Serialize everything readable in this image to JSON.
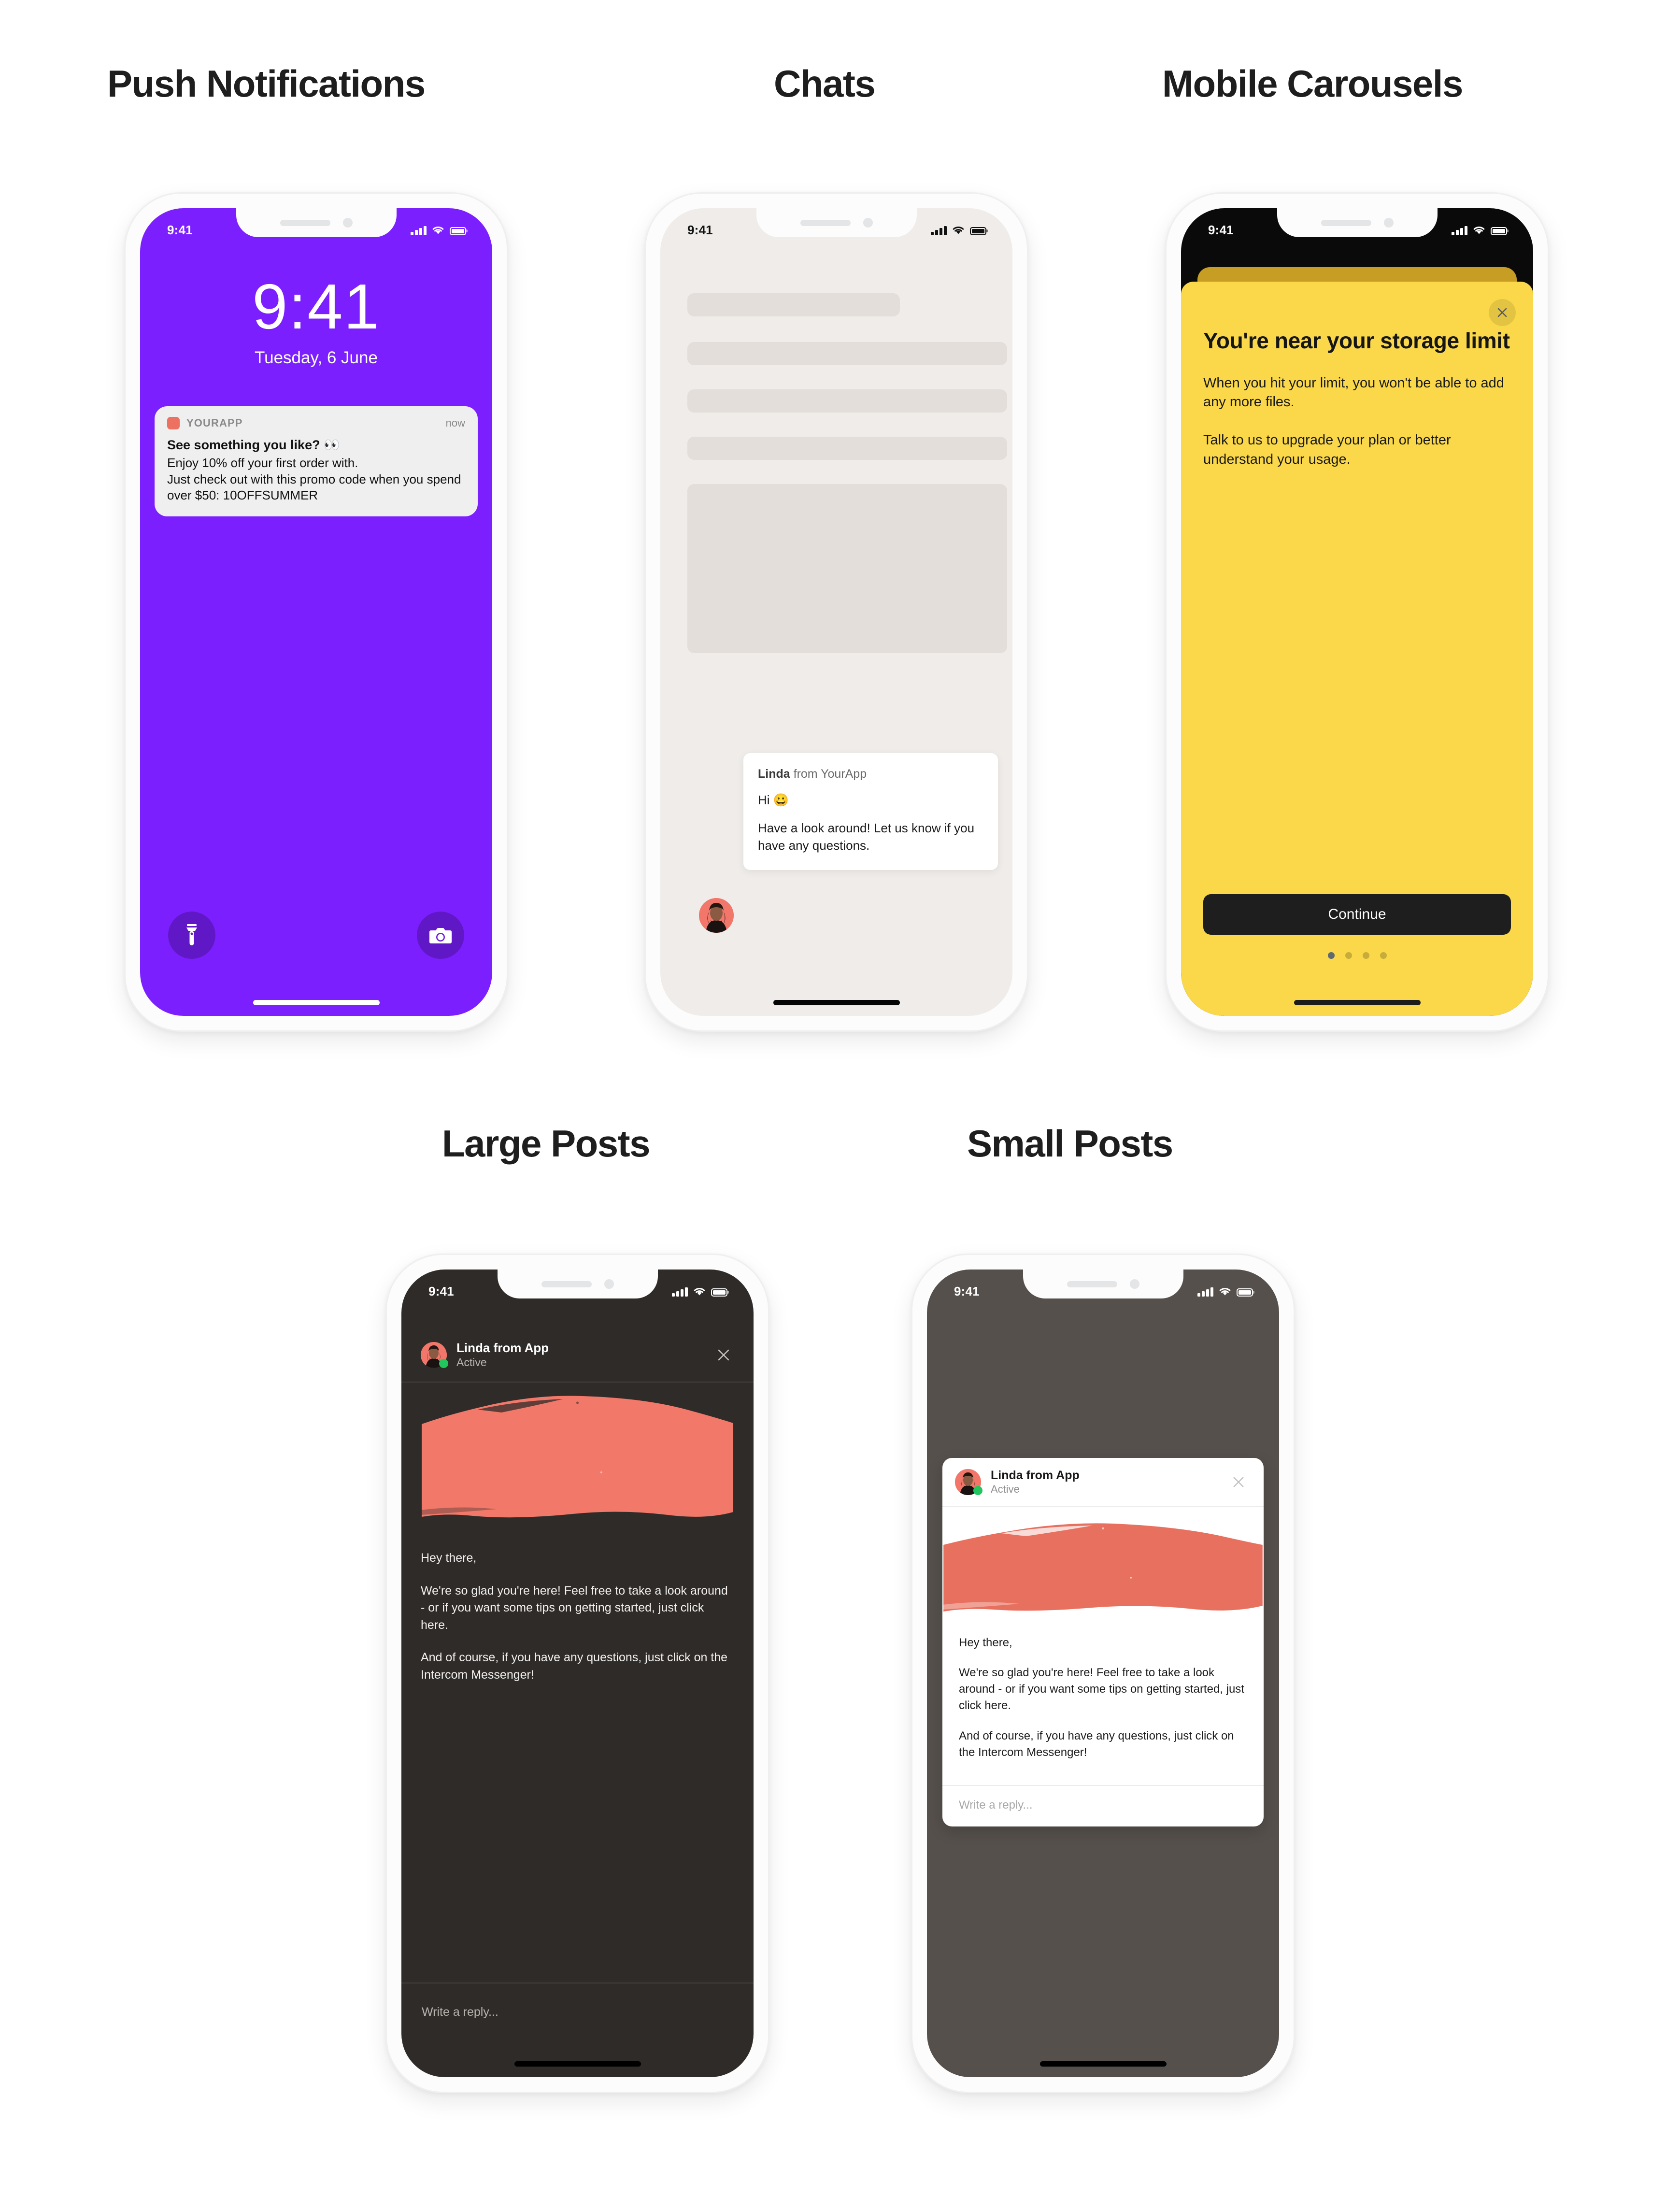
{
  "sections": [
    {
      "id": "push",
      "title": "Push Notifications"
    },
    {
      "id": "chats",
      "title": "Chats"
    },
    {
      "id": "carousels",
      "title": "Mobile Carousels"
    },
    {
      "id": "large",
      "title": "Large Posts"
    },
    {
      "id": "small",
      "title": "Small Posts"
    }
  ],
  "status_bar": {
    "time": "9:41",
    "signal_icon": "cellular-bars-icon",
    "wifi_icon": "wifi-icon",
    "battery_icon": "battery-icon"
  },
  "push_phone": {
    "lock_time": "9:41",
    "lock_date": "Tuesday, 6 June",
    "background_color": "#7C1FFF",
    "notification": {
      "app_icon": "yourapp-icon",
      "app_name": "YOURAPP",
      "timestamp": "now",
      "title": "See something you like? 👀",
      "body": "Enjoy 10% off your first order with.\nJust check out with this promo code when you spend over $50: 10OFFSUMMER"
    },
    "left_button_icon": "flashlight-icon",
    "right_button_icon": "camera-icon"
  },
  "chats_phone": {
    "background_color": "#EFECE9",
    "skeleton_bars": 5,
    "bubble": {
      "sender_name": "Linda",
      "sender_suffix": " from YourApp",
      "message_1": "Hi 😀",
      "message_2": "Have a look around! Let us know if you have any questions."
    },
    "avatar_icon": "linda-avatar"
  },
  "carousel_phone": {
    "background_color": "#FAD849",
    "behind_card_color": "#C79E23",
    "close_icon": "close-icon",
    "title": "You're near your storage limit",
    "paragraph_1": "When you hit your limit, you won't be able to add any more files.",
    "paragraph_2": "Talk to us to upgrade your plan or better understand your usage.",
    "cta_label": "Continue",
    "dots_total": 4,
    "dots_active_index": 0
  },
  "large_post_phone": {
    "background_color": "#2E2B29",
    "header": {
      "avatar_icon": "linda-avatar",
      "presence_icon": "online-dot-icon",
      "name": "Linda from App",
      "status": "Active",
      "close_icon": "close-icon"
    },
    "hero_image_color": "#F2796A",
    "paragraphs": [
      "Hey there,",
      "We're so glad you're here! Feel free to take a look around - or if you want some tips on getting started, just click here.",
      "And of course, if you have any questions, just click on the Intercom Messenger!"
    ],
    "reply_placeholder": "Write a reply..."
  },
  "small_post_phone": {
    "background_color": "#55504C",
    "card_background": "#FFFFFF",
    "header": {
      "avatar_icon": "linda-avatar",
      "presence_icon": "online-dot-icon",
      "name": "Linda from App",
      "status": "Active",
      "close_icon": "close-icon"
    },
    "hero_image_color": "#E8705F",
    "paragraphs": [
      "Hey there,",
      "We're so glad you're here! Feel free to take a look around - or if you want some tips on getting started, just click here.",
      "And of course, if you have any questions, just click on the Intercom Messenger!"
    ],
    "reply_placeholder": "Write a reply..."
  }
}
